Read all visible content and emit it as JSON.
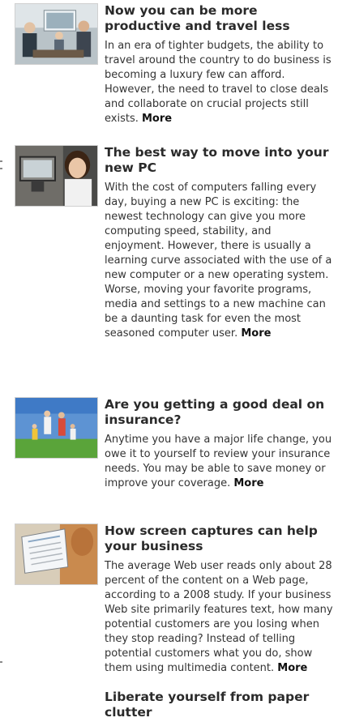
{
  "articles": [
    {
      "thumb_icon": "video-conference-photo-icon",
      "title": "Now you can be more productive and travel less",
      "body": "In an era of tighter budgets, the ability to travel around the country to do business is becoming a luxury few can afford. However, the need to travel to close deals and collaborate on crucial projects still exists.",
      "more_label": "More"
    },
    {
      "thumb_icon": "woman-with-computer-photo-icon",
      "title": "The best way to move into your new PC",
      "body": "With the cost of computers falling every day, buying a new PC is exciting: the newest technology can give you more computing speed, stability, and enjoyment. However, there is usually a learning curve associated with the use of a new computer or a new operating system. Worse, moving your favorite programs, media and settings to a new machine can be a daunting task for even the most seasoned computer user.",
      "more_label": "More"
    },
    {
      "thumb_icon": "family-in-field-photo-icon",
      "title": "Are you getting a good deal on insurance?",
      "body": "Anytime you have a major life change, you owe it to yourself to review your insurance needs. You may be able to save money or improve your coverage.",
      "more_label": "More"
    },
    {
      "thumb_icon": "screen-capture-photo-icon",
      "title": "How screen captures can help your business",
      "body": "The average Web user reads only about 28 percent of the content on a Web page, according to a 2008 study. If your business Web site primarily features text, how many potential customers are you losing when they stop reading? Instead of telling potential customers what you do, show them using multimedia content.",
      "more_label": "More"
    },
    {
      "title": "Liberate yourself from paper clutter"
    }
  ],
  "colors": {
    "title": "#2a2a2a",
    "body": "#333333",
    "link": "#111111"
  }
}
